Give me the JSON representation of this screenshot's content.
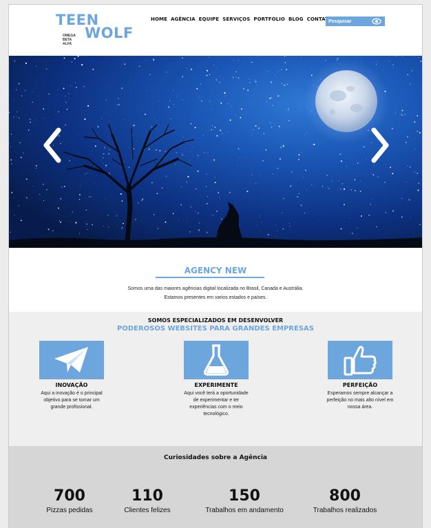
{
  "header": {
    "logo": {
      "line1": "TEEN",
      "line2": "WOLF",
      "tagline": [
        "OMEGA",
        "BETA",
        "ALFA"
      ]
    },
    "nav": [
      "HOME",
      "AGÊNCIA",
      "EQUIPE",
      "SERVIÇOS",
      "PORTFOLIO",
      "BLOG",
      "CONTATO"
    ],
    "search": {
      "placeholder": "Pesquisar",
      "icon": "eye-icon"
    }
  },
  "hero": {
    "icons": [
      "chevron-left-icon",
      "chevron-right-icon"
    ],
    "scene": "moon-tree-wolf"
  },
  "agency": {
    "title": "AGENCY NEW",
    "lines": [
      "Somos uma das maiores agências digital localizada no Brasil, Canada e Austrália.",
      "Estamos presentes em varios estados e países."
    ]
  },
  "specialized": {
    "title1": "SOMOS ESPECIALIZADOS EM DESENVOLVER",
    "title2": "PODEROSOS WEBSITES PARA GRANDES EMPRESAS",
    "features": [
      {
        "title": "INOVAÇÃO",
        "icon": "paper-plane-icon",
        "text": "Aqui a inovação é o principal objetivo para se tornar um grande profissional."
      },
      {
        "title": "EXPERIMENTE",
        "icon": "flask-icon",
        "text": "Aqui você terá a oportunidade de experimentar e ter experiências com o meio tecnológico."
      },
      {
        "title": "PERFEIÇÃO",
        "icon": "thumbs-up-icon",
        "text": "Esperamos sempre alcançar a perfeição no mais alto nível em nossa área."
      }
    ]
  },
  "stats": {
    "title": "Curiosidades sobre a Agência",
    "items": [
      {
        "value": "700",
        "label": "Pizzas pedidas"
      },
      {
        "value": "110",
        "label": "Clientes felizes"
      },
      {
        "value": "150",
        "label": "Trabalhos em andamento"
      },
      {
        "value": "800",
        "label": "Trabalhos realizados"
      }
    ]
  },
  "colors": {
    "accent": "#6da6dc",
    "stats_bg": "#d6d6d6",
    "spec_bg": "#efefef"
  }
}
